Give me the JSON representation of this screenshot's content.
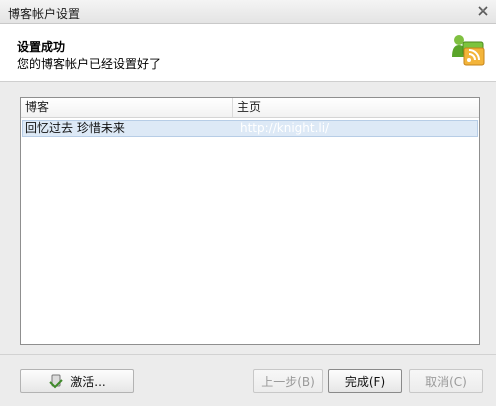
{
  "window": {
    "title": "博客帐户设置"
  },
  "header": {
    "title": "设置成功",
    "subtitle": "您的博客帐户已经设置好了"
  },
  "list": {
    "columns": [
      "博客",
      "主页"
    ],
    "rows": [
      {
        "blog": "回忆过去 珍惜未来",
        "homepage": "http://knight.li/"
      }
    ]
  },
  "buttons": {
    "activate": "激活...",
    "prev": "上一步(B)",
    "finish": "完成(F)",
    "cancel": "取消(C)"
  }
}
